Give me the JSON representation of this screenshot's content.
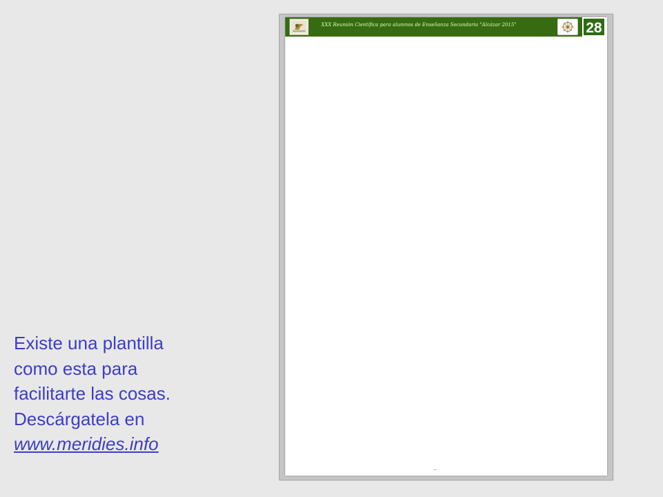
{
  "instructions": {
    "line1": "Existe una plantilla",
    "line2": "como esta para",
    "line3": "facilitarte las cosas.",
    "line4": "Descárgatela en",
    "link": "www.meridies.info"
  },
  "template_preview": {
    "header_title": "XXX Reunión Científica para alumnos de Enseñanza Secundaria \"Alcázar 2015\"",
    "page_number": "28",
    "left_logo_icon": "school-logo-icon",
    "right_logo_icon": "sun-compass-logo-icon"
  },
  "colors": {
    "background": "#e8e8e8",
    "text": "#3d3dc8",
    "header_green": "#366b12",
    "header_text": "#e3ffb8"
  }
}
